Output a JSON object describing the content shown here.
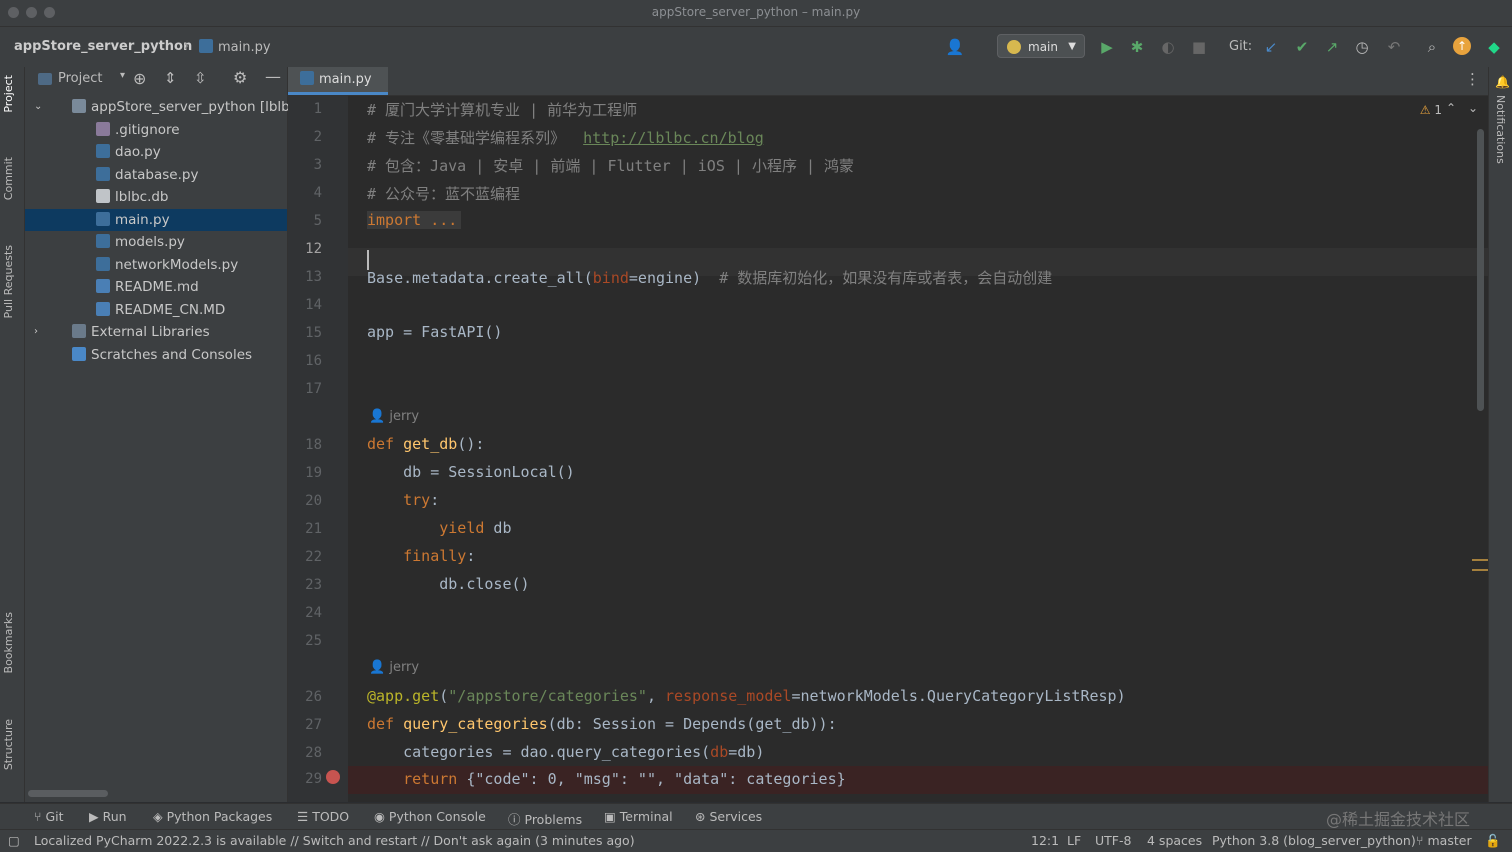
{
  "window": {
    "title": "appStore_server_python – main.py"
  },
  "navbar": {
    "project": "appStore_server_python",
    "file": "main.py",
    "run_config": "main",
    "git_label": "Git:"
  },
  "left_stripe": {
    "project": "Project",
    "commit": "Commit",
    "pull_requests": "Pull Requests",
    "bookmarks": "Bookmarks",
    "structure": "Structure"
  },
  "project_panel": {
    "title": "Project",
    "tree": [
      {
        "label": "appStore_server_python [lblbc]",
        "type": "folder"
      },
      {
        "label": ".gitignore",
        "type": "file"
      },
      {
        "label": "dao.py",
        "type": "py"
      },
      {
        "label": "database.py",
        "type": "py"
      },
      {
        "label": "lblbc.db",
        "type": "db"
      },
      {
        "label": "main.py",
        "type": "py",
        "selected": true
      },
      {
        "label": "models.py",
        "type": "py"
      },
      {
        "label": "networkModels.py",
        "type": "py"
      },
      {
        "label": "README.md",
        "type": "md"
      },
      {
        "label": "README_CN.MD",
        "type": "md"
      },
      {
        "label": "External Libraries",
        "type": "lib"
      },
      {
        "label": "Scratches and Consoles",
        "type": "scratch"
      }
    ]
  },
  "editor": {
    "tab": "main.py",
    "warnings": "1",
    "author": "jerry",
    "line_numbers": [
      "1",
      "2",
      "3",
      "4",
      "5",
      "12",
      "13",
      "14",
      "15",
      "16",
      "17",
      "18",
      "19",
      "20",
      "21",
      "22",
      "23",
      "24",
      "25",
      "26",
      "27",
      "28",
      "29"
    ],
    "code": {
      "l1": "# 厦门大学计算机专业 | 前华为工程师",
      "l2a": "# 专注《零基础学编程系列》  ",
      "l2b": "http://lblbc.cn/blog",
      "l3": "# 包含：Java | 安卓 | 前端 | Flutter | iOS | 小程序 | 鸿蒙",
      "l4": "# 公众号：蓝不蓝编程",
      "l5": "import ...",
      "l13a": "Base.metadata.create_all(",
      "l13b": "bind",
      "l13c": "=engine)  ",
      "l13d": "# 数据库初始化，如果没有库或者表，会自动创建",
      "l15": "app = FastAPI()",
      "l18a": "def ",
      "l18b": "get_db",
      "l18c": "():",
      "l19": "    db = SessionLocal()",
      "l20a": "    ",
      "l20b": "try",
      "l20c": ":",
      "l21a": "        ",
      "l21b": "yield",
      "l21c": " db",
      "l22a": "    ",
      "l22b": "finally",
      "l22c": ":",
      "l23": "        db.close()",
      "l26a": "@app.get",
      "l26b": "(",
      "l26c": "\"/appstore/categories\"",
      "l26d": ", ",
      "l26e": "response_model",
      "l26f": "=networkModels.QueryCategoryListResp)",
      "l27a": "def ",
      "l27b": "query_categories",
      "l27c": "(db: Session = Depends(get_db)):",
      "l28a": "    categories = dao.query_categories(",
      "l28b": "db",
      "l28c": "=db)",
      "l29a": "    ",
      "l29b": "return",
      "l29c": " {\"code\": 0, \"msg\": \"\", \"data\": categories}"
    }
  },
  "right_stripe": {
    "notifications": "Notifications"
  },
  "bottom_tabs": [
    "Git",
    "Run",
    "Python Packages",
    "TODO",
    "Python Console",
    "Problems",
    "Terminal",
    "Services"
  ],
  "watermark": "@稀土掘金技术社区",
  "status": {
    "message": "Localized PyCharm 2022.2.3 is available // Switch and restart // Don't ask again (3 minutes ago)",
    "position": "12:1",
    "line_sep": "LF",
    "encoding": "UTF-8",
    "indent": "4 spaces",
    "interpreter": "Python 3.8 (blog_server_python)",
    "branch": "master"
  },
  "colors": {
    "selection": "#0d3a60",
    "keyword": "#cc7832",
    "function": "#ffc66d",
    "string": "#6a8759",
    "comment": "#808080"
  }
}
